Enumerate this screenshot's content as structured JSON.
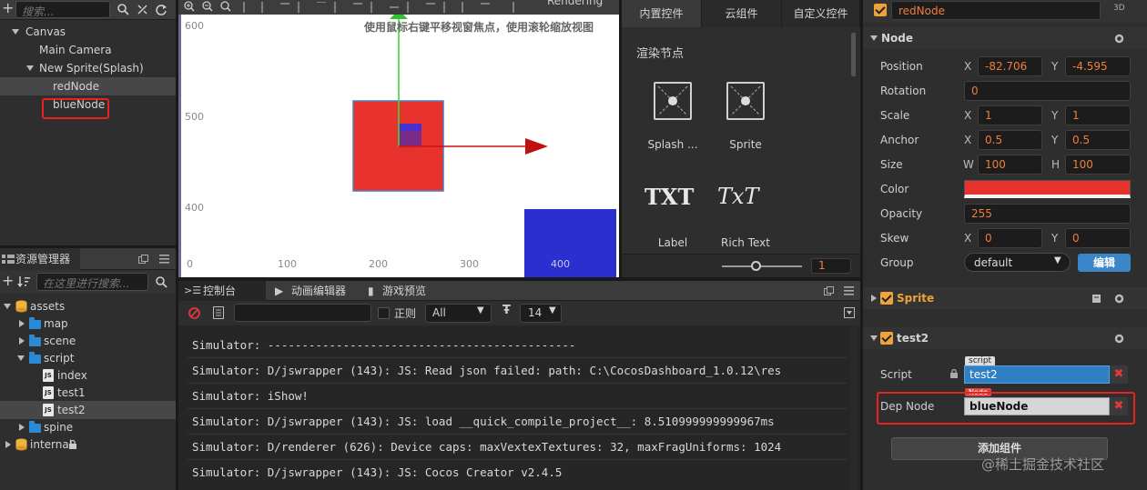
{
  "hierarchy": {
    "search_placeholder": "搜索...",
    "nodes": [
      {
        "label": "Canvas"
      },
      {
        "label": "Main Camera"
      },
      {
        "label": "New Sprite(Splash)"
      },
      {
        "label": "redNode"
      },
      {
        "label": "blueNode"
      }
    ]
  },
  "assets": {
    "tab_label": "资源管理器",
    "search_placeholder": "在这里进行搜索...",
    "tree": [
      {
        "label": "assets"
      },
      {
        "label": "map"
      },
      {
        "label": "scene"
      },
      {
        "label": "script"
      },
      {
        "label": "index"
      },
      {
        "label": "test1"
      },
      {
        "label": "test2"
      },
      {
        "label": "spine"
      },
      {
        "label": "internal"
      }
    ],
    "js_badge": "JS"
  },
  "scene": {
    "rendering_label": "Rendering",
    "hint": "使用鼠标右键平移视窗焦点，使用滚轮缩放视图",
    "y_ticks": [
      "600",
      "500",
      "400"
    ],
    "x_ticks": [
      "0",
      "100",
      "200",
      "300",
      "400"
    ]
  },
  "widgets": {
    "tabs": [
      "内置控件",
      "云组件",
      "自定义控件"
    ],
    "section": "渲染节点",
    "items": [
      {
        "label": "Splash ..."
      },
      {
        "label": "Sprite"
      },
      {
        "label": "Label",
        "glyph": "TXT"
      },
      {
        "label": "Rich Text",
        "glyph": "TxT"
      }
    ],
    "zoom_value": "1"
  },
  "console": {
    "tabs": [
      "控制台",
      "动画编辑器",
      "游戏预览"
    ],
    "regex_label": "正则",
    "level_select": "All",
    "font_size": "14",
    "lines": [
      "Simulator: ---------------------------------------------",
      "Simulator: D/jswrapper (143): JS: Read json failed: path: C:\\CocosDashboard_1.0.12\\res",
      "Simulator: iShow!",
      "Simulator: D/jswrapper (143): JS: load __quick_compile_project__: 8.510999999999967ms",
      "Simulator: D/renderer (626): Device caps: maxVextexTextures: 32, maxFragUniforms: 1024",
      "Simulator: D/jswrapper (143): JS: Cocos Creator v2.4.5"
    ]
  },
  "inspector": {
    "node_name": "redNode",
    "badge_3d": "3D",
    "node_section": "Node",
    "position": {
      "label": "Position",
      "x": "-82.706",
      "y": "-4.595"
    },
    "rotation": {
      "label": "Rotation",
      "value": "0"
    },
    "scale": {
      "label": "Scale",
      "x": "1",
      "y": "1"
    },
    "anchor": {
      "label": "Anchor",
      "x": "0.5",
      "y": "0.5"
    },
    "size": {
      "label": "Size",
      "w": "100",
      "h": "100"
    },
    "color": {
      "label": "Color",
      "value": "#e8322e"
    },
    "opacity": {
      "label": "Opacity",
      "value": "255"
    },
    "skew": {
      "label": "Skew",
      "x": "0",
      "y": "0"
    },
    "group": {
      "label": "Group",
      "value": "default",
      "edit_button": "编辑"
    },
    "axis": {
      "x": "X",
      "y": "Y",
      "w": "W",
      "h": "H"
    },
    "sprite_section": "Sprite",
    "test2_section": "test2",
    "script_tag": "script",
    "script_label": "Script",
    "script_value": "test2",
    "node_tag": "Node",
    "dep_node_label": "Dep Node",
    "dep_node_value": "blueNode",
    "add_component": "添加组件"
  },
  "watermark": "@稀土掘金技术社区",
  "colors": {
    "accent": "#f0a33a",
    "red_node": "#e8322e",
    "blue_node": "#2b2fd0",
    "highlight": "#e8231c"
  }
}
